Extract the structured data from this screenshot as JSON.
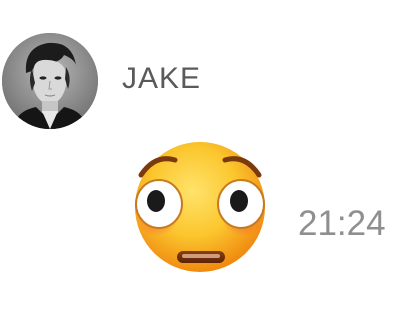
{
  "message": {
    "sender_name": "JAKE",
    "avatar_icon": "profile-photo-avatar",
    "content_icon": "flushed-face-emoji",
    "timestamp": "21:24"
  },
  "colors": {
    "name_text": "#5a5a5a",
    "timestamp_text": "#8f8f8f",
    "emoji_face": "#f9c22e"
  }
}
